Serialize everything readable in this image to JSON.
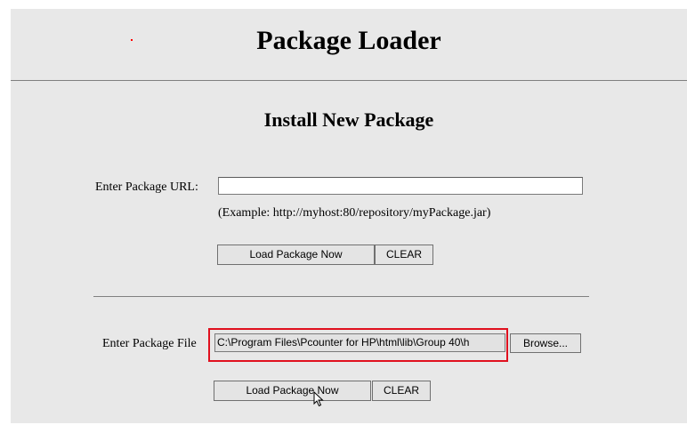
{
  "header": {
    "title": "Package Loader"
  },
  "main": {
    "subtitle": "Install New Package",
    "url_section": {
      "label": "Enter Package URL:",
      "input_value": "",
      "example": "(Example: http://myhost:80/repository/myPackage.jar)",
      "load_button": "Load Package Now",
      "clear_button": "CLEAR"
    },
    "file_section": {
      "label": "Enter Package File",
      "input_value": "C:\\Program Files\\Pcounter for HP\\html\\lib\\Group 40\\h",
      "browse_button": "Browse...",
      "load_button": "Load Package Now",
      "clear_button": "CLEAR"
    }
  },
  "icons": {
    "cursor": "mouse-pointer-icon"
  },
  "colors": {
    "panel_background": "#e8e8e8",
    "highlight_border": "#e0101e",
    "rule": "#808080",
    "red_dot": "#ff0000"
  }
}
